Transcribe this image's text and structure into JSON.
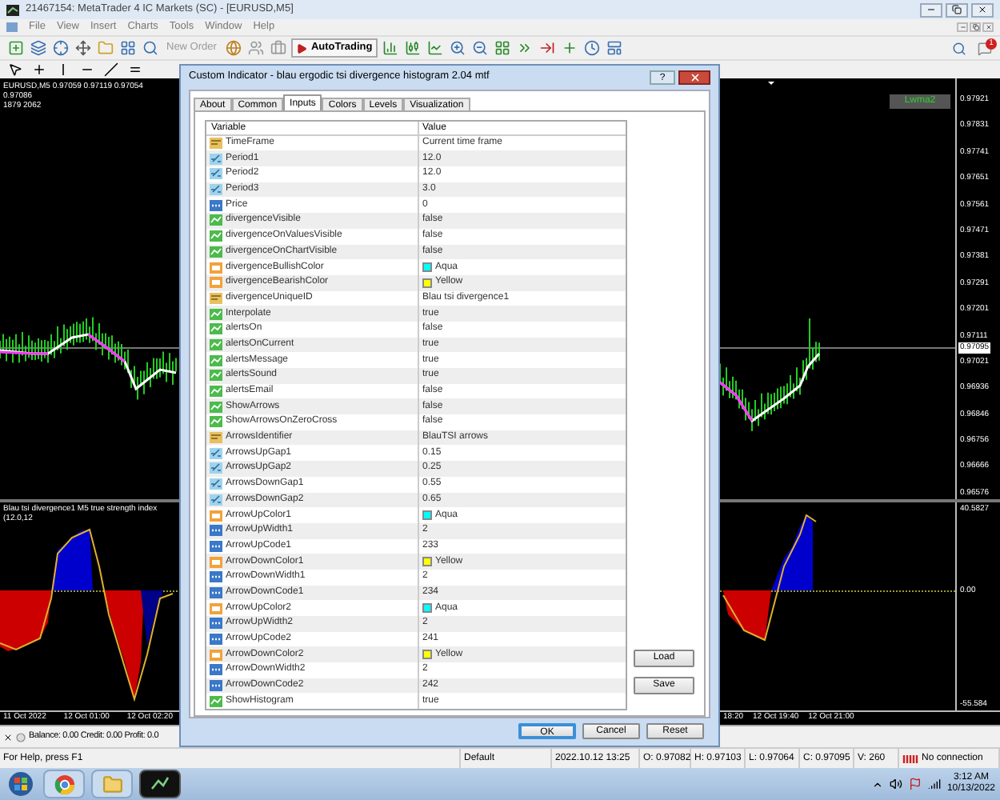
{
  "window": {
    "title": "21467154: MetaTrader 4 IC Markets (SC) - [EURUSD,M5]"
  },
  "menu": [
    "File",
    "View",
    "Insert",
    "Charts",
    "Tools",
    "Window",
    "Help"
  ],
  "toolbar": {
    "new_order": "New Order",
    "auto_trading": "AutoTrading",
    "notification_count": "1"
  },
  "chart": {
    "header": "EURUSD,M5  0.97059 0.97119 0.97054 0.97086",
    "header_2": "1879  2062",
    "legend_label": "Lwma2",
    "indicator_label": "Blau tsi divergence1 M5 true strength index (12.0,12",
    "price_scale": [
      "0.97921",
      "0.97831",
      "0.97741",
      "0.97651",
      "0.97561",
      "0.97471",
      "0.97381",
      "0.97291",
      "0.97201",
      "0.97111",
      "0.97021",
      "0.96936",
      "0.96846",
      "0.96756",
      "0.96666",
      "0.96576"
    ],
    "current_price": "0.97095",
    "indicator_scale": [
      "40.5827",
      "0.00",
      "-55.584"
    ],
    "time_axis_left": [
      "11 Oct 2022",
      "12 Oct 01:00",
      "12 Oct 02:20"
    ],
    "time_axis_right": [
      "18:20",
      "12 Oct 19:40",
      "12 Oct 21:00"
    ]
  },
  "terminal": {
    "summary": "Balance: 0.00  Credit: 0.00  Profit: 0.0"
  },
  "dialog": {
    "title": "Custom Indicator - blau ergodic tsi divergence histogram 2.04 mtf",
    "help_glyph": "?",
    "tabs": [
      {
        "label": "About",
        "selected": false
      },
      {
        "label": "Common",
        "selected": false
      },
      {
        "label": "Inputs",
        "selected": true
      },
      {
        "label": "Colors",
        "selected": false
      },
      {
        "label": "Levels",
        "selected": false
      },
      {
        "label": "Visualization",
        "selected": false
      }
    ],
    "columns": [
      "Variable",
      "Value"
    ],
    "rows": [
      {
        "kind": "string",
        "name": "TimeFrame",
        "value": "Current time frame"
      },
      {
        "kind": "double",
        "name": "Period1",
        "value": "12.0"
      },
      {
        "kind": "double",
        "name": "Period2",
        "value": "12.0"
      },
      {
        "kind": "double",
        "name": "Period3",
        "value": "3.0"
      },
      {
        "kind": "int",
        "name": "Price",
        "value": "0"
      },
      {
        "kind": "bool",
        "name": "divergenceVisible",
        "value": "false"
      },
      {
        "kind": "bool",
        "name": "divergenceOnValuesVisible",
        "value": "false"
      },
      {
        "kind": "bool",
        "name": "divergenceOnChartVisible",
        "value": "false"
      },
      {
        "kind": "color",
        "name": "divergenceBullishColor",
        "value": "Aqua",
        "color": "#00ffff"
      },
      {
        "kind": "color",
        "name": "divergenceBearishColor",
        "value": "Yellow",
        "color": "#ffff00"
      },
      {
        "kind": "string",
        "name": "divergenceUniqueID",
        "value": "Blau tsi divergence1"
      },
      {
        "kind": "bool",
        "name": "Interpolate",
        "value": "true"
      },
      {
        "kind": "bool",
        "name": "alertsOn",
        "value": "false"
      },
      {
        "kind": "bool",
        "name": "alertsOnCurrent",
        "value": "true"
      },
      {
        "kind": "bool",
        "name": "alertsMessage",
        "value": "true"
      },
      {
        "kind": "bool",
        "name": "alertsSound",
        "value": "true"
      },
      {
        "kind": "bool",
        "name": "alertsEmail",
        "value": "false"
      },
      {
        "kind": "bool",
        "name": "ShowArrows",
        "value": "false"
      },
      {
        "kind": "bool",
        "name": "ShowArrowsOnZeroCross",
        "value": "false"
      },
      {
        "kind": "string",
        "name": "ArrowsIdentifier",
        "value": "BlauTSI arrows"
      },
      {
        "kind": "double",
        "name": "ArrowsUpGap1",
        "value": "0.15"
      },
      {
        "kind": "double",
        "name": "ArrowsUpGap2",
        "value": "0.25"
      },
      {
        "kind": "double",
        "name": "ArrowsDownGap1",
        "value": "0.55"
      },
      {
        "kind": "double",
        "name": "ArrowsDownGap2",
        "value": "0.65"
      },
      {
        "kind": "color",
        "name": "ArrowUpColor1",
        "value": "Aqua",
        "color": "#00ffff"
      },
      {
        "kind": "int",
        "name": "ArrowUpWidth1",
        "value": "2"
      },
      {
        "kind": "int",
        "name": "ArrowUpCode1",
        "value": "233"
      },
      {
        "kind": "color",
        "name": "ArrowDownColor1",
        "value": "Yellow",
        "color": "#ffff00"
      },
      {
        "kind": "int",
        "name": "ArrowDownWidth1",
        "value": "2"
      },
      {
        "kind": "int",
        "name": "ArrowDownCode1",
        "value": "234"
      },
      {
        "kind": "color",
        "name": "ArrowUpColor2",
        "value": "Aqua",
        "color": "#00ffff"
      },
      {
        "kind": "int",
        "name": "ArrowUpWidth2",
        "value": "2"
      },
      {
        "kind": "int",
        "name": "ArrowUpCode2",
        "value": "241"
      },
      {
        "kind": "color",
        "name": "ArrowDownColor2",
        "value": "Yellow",
        "color": "#ffff00"
      },
      {
        "kind": "int",
        "name": "ArrowDownWidth2",
        "value": "2"
      },
      {
        "kind": "int",
        "name": "ArrowDownCode2",
        "value": "242"
      },
      {
        "kind": "bool",
        "name": "ShowHistogram",
        "value": "true"
      }
    ],
    "side_buttons": [
      "Load",
      "Save"
    ],
    "footer_buttons": [
      {
        "label": "OK",
        "default": true
      },
      {
        "label": "Cancel",
        "default": false
      },
      {
        "label": "Reset",
        "default": false
      }
    ]
  },
  "status_bar": [
    "For Help, press F1",
    "Default",
    "2022.10.12 13:25",
    "O: 0.97082",
    "H: 0.97103",
    "L: 0.97064",
    "C: 0.97095",
    "V: 260",
    "No connection"
  ],
  "taskbar": {
    "time": "3:12 AM",
    "date": "10/13/2022"
  }
}
